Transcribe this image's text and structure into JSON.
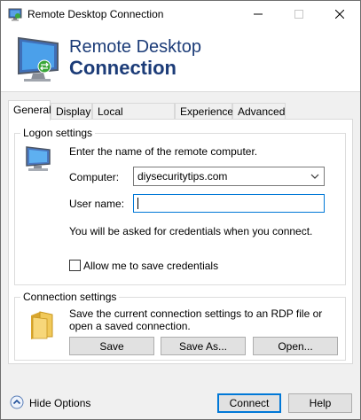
{
  "window": {
    "title": "Remote Desktop Connection",
    "controls": {
      "minimize": "—",
      "maximize": "☐",
      "close": "✕"
    }
  },
  "banner": {
    "line1": "Remote Desktop",
    "line2": "Connection"
  },
  "tabs": [
    {
      "label": "General",
      "active": true
    },
    {
      "label": "Display"
    },
    {
      "label": "Local Resources"
    },
    {
      "label": "Experience"
    },
    {
      "label": "Advanced"
    }
  ],
  "logon": {
    "group_label": "Logon settings",
    "instruction": "Enter the name of the remote computer.",
    "computer_label": "Computer:",
    "computer_value": "diysecuritytips.com",
    "username_label": "User name:",
    "username_value": "",
    "credentials_note": "You will be asked for credentials when you connect.",
    "save_credentials_label": "Allow me to save credentials",
    "save_credentials_checked": false
  },
  "connection": {
    "group_label": "Connection settings",
    "description": "Save the current connection settings to an RDP file or open a saved connection.",
    "save_label": "Save",
    "save_as_label": "Save As...",
    "open_label": "Open..."
  },
  "footer": {
    "hide_options_label": "Hide Options",
    "connect_label": "Connect",
    "help_label": "Help"
  },
  "icons": {
    "title": "rdp-app-icon",
    "banner": "rdp-monitor-icon",
    "logon": "computer-icon",
    "connection": "folder-icon",
    "hide_options": "chevron-up-circle-icon",
    "combo": "chevron-down-icon"
  },
  "colors": {
    "banner_text": "#1c3c78",
    "focus_border": "#0078d7"
  }
}
